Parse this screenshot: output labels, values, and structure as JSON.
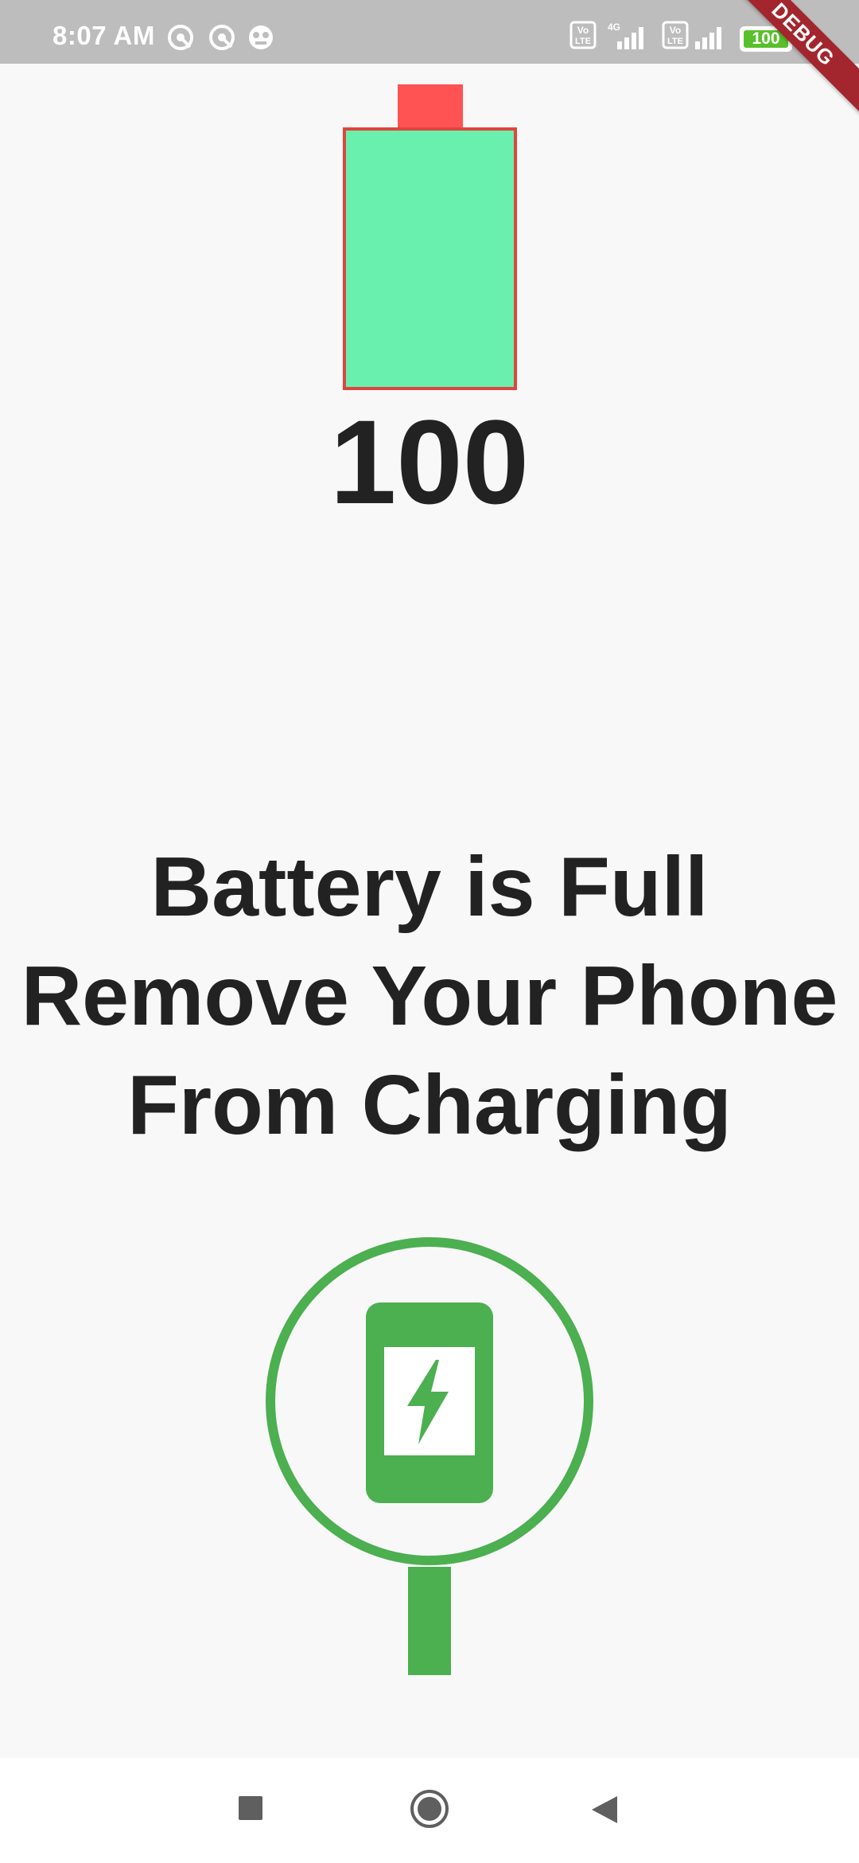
{
  "status_bar": {
    "time": "8:07 AM",
    "battery_text": "100",
    "network_label": "4G",
    "volte_label_1": "Vo LTE",
    "volte_label_2": "Vo LTE",
    "icons": [
      "vpn-key-icon",
      "vpn-key-icon",
      "app-notification-icon",
      "volte-icon",
      "signal-4g-icon",
      "volte-icon",
      "signal-icon",
      "battery-icon",
      "charging-bolt-icon"
    ]
  },
  "debug_banner": "DEBUG",
  "battery": {
    "level": "100",
    "fill_fraction": 1.0,
    "fill_color": "#69f0ae",
    "cap_color": "#ff5252",
    "border_color": "#e0453d"
  },
  "message": {
    "line1": "Battery is Full",
    "line2": "Remove Your Phone",
    "line3": "From Charging"
  },
  "charging_graphic": {
    "icon": "phone-charging-icon",
    "color": "#4caf50"
  },
  "nav_bar": {
    "icons": [
      "recents-square-icon",
      "home-circle-icon",
      "back-triangle-icon"
    ]
  }
}
